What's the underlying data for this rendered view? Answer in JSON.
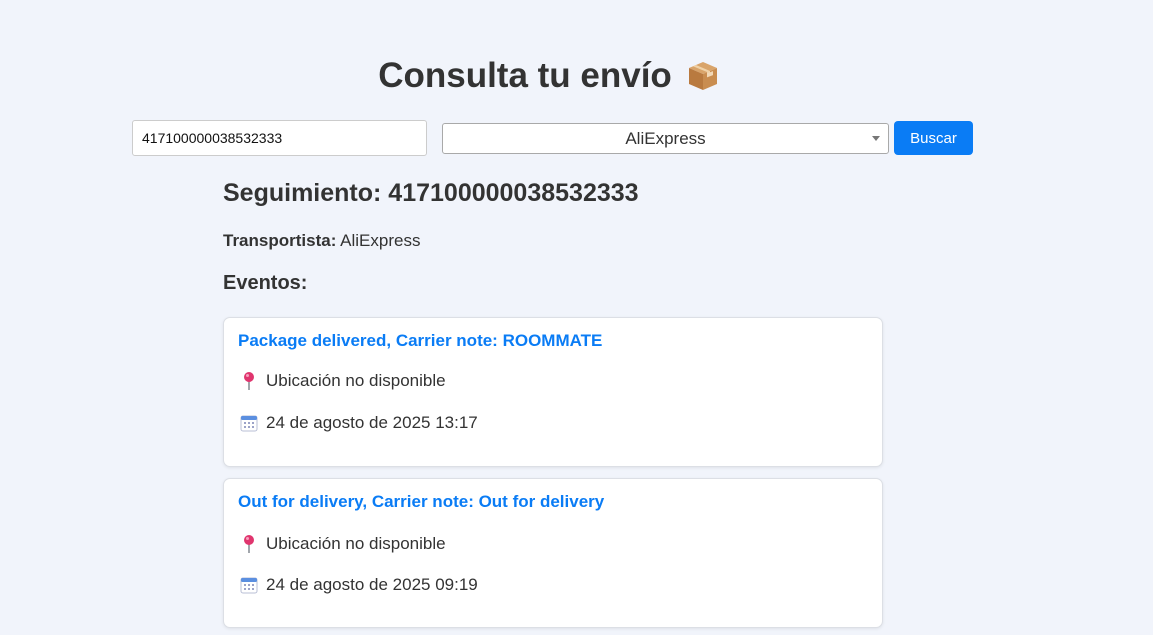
{
  "header": {
    "title": "Consulta tu envío",
    "title_icon": "package-box-icon"
  },
  "search": {
    "tracking_value": "417100000038532333",
    "carrier_selected": "AliExpress",
    "button_label": "Buscar"
  },
  "result": {
    "heading_prefix": "Seguimiento:",
    "tracking_number": "417100000038532333",
    "carrier_label": "Transportista:",
    "carrier_value": "AliExpress",
    "events_heading": "Eventos:"
  },
  "events": [
    {
      "title": "Package delivered, Carrier note: ROOMMATE",
      "location": "Ubicación no disponible",
      "date": "24 de agosto de 2025 13:17",
      "location_icon": "pushpin-icon",
      "date_icon": "calendar-icon"
    },
    {
      "title": "Out for delivery, Carrier note: Out for delivery",
      "location": "Ubicación no disponible",
      "date": "24 de agosto de 2025 09:19",
      "location_icon": "pushpin-icon",
      "date_icon": "calendar-icon"
    }
  ],
  "colors": {
    "background": "#f1f4fb",
    "accent": "#0a7cf5",
    "text": "#333333"
  }
}
